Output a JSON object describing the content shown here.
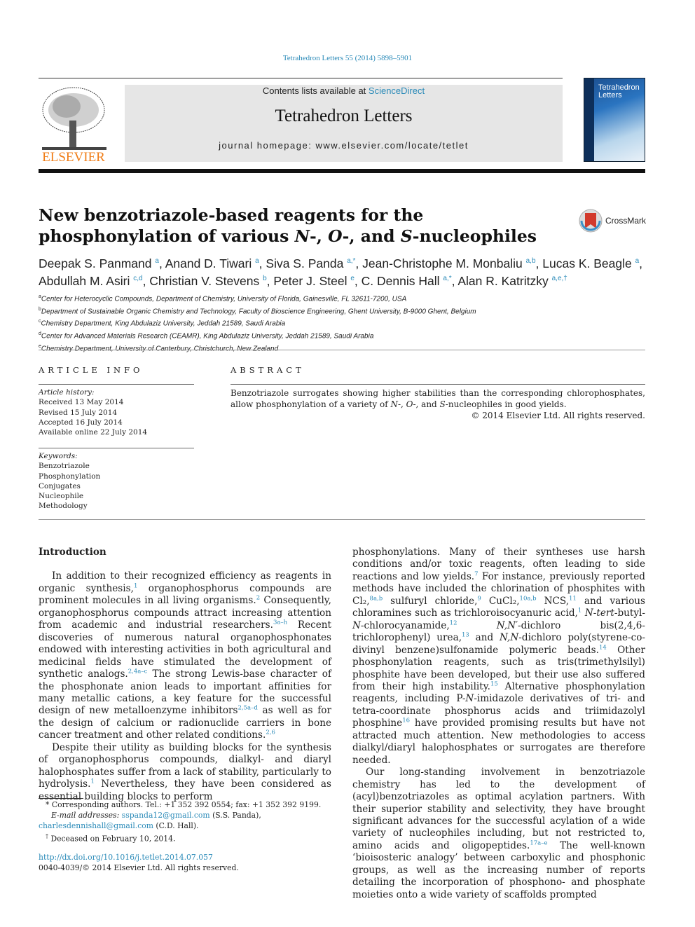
{
  "header": {
    "journal_ref": "Tetrahedron Letters 55 (2014) 5898–5901",
    "contents_prefix": "Contents lists available at ",
    "sciencedirect": "ScienceDirect",
    "journal_title": "Tetrahedron Letters",
    "homepage": "journal homepage: www.elsevier.com/locate/tetlet",
    "publisher_logo": "ELSEVIER",
    "cover_title": "Tetrahedron Letters"
  },
  "article": {
    "title_parts": [
      {
        "t": "New benzotriazole-based reagents for the phosphonylation of various "
      },
      {
        "t": "N",
        "i": true
      },
      {
        "t": "-, "
      },
      {
        "t": "O",
        "i": true
      },
      {
        "t": "-, and "
      },
      {
        "t": "S",
        "i": true
      },
      {
        "t": "-nucleophiles"
      }
    ],
    "crossmark": "CrossMark",
    "authors": [
      {
        "name": "Deepak S. Panmand",
        "aff": "a"
      },
      {
        "name": "Anand D. Tiwari",
        "aff": "a"
      },
      {
        "name": "Siva S. Panda",
        "aff": "a,*"
      },
      {
        "name": "Jean-Christophe M. Monbaliu",
        "aff": "a,b"
      },
      {
        "name": "Lucas K. Beagle",
        "aff": "a"
      },
      {
        "name": "Abdullah M. Asiri",
        "aff": "c,d"
      },
      {
        "name": "Christian V. Stevens",
        "aff": "b"
      },
      {
        "name": "Peter J. Steel",
        "aff": "e"
      },
      {
        "name": "C. Dennis Hall",
        "aff": "a,*"
      },
      {
        "name": "Alan R. Katritzky",
        "aff": "a,e,†"
      }
    ],
    "affiliations": [
      {
        "key": "a",
        "text": "Center for Heterocyclic Compounds, Department of Chemistry, University of Florida, Gainesville, FL 32611-7200, USA"
      },
      {
        "key": "b",
        "text": "Department of Sustainable Organic Chemistry and Technology, Faculty of Bioscience Engineering, Ghent University, B-9000 Ghent, Belgium"
      },
      {
        "key": "c",
        "text": "Chemistry Department, King Abdulaziz University, Jeddah 21589, Saudi Arabia"
      },
      {
        "key": "d",
        "text": "Center for Advanced Materials Research (CEAMR), King Abdulaziz University, Jeddah 21589, Saudi Arabia"
      },
      {
        "key": "e",
        "text": "Chemistry Department, University of Canterbury, Christchurch, New Zealand"
      }
    ]
  },
  "article_info": {
    "heading": "ARTICLE INFO",
    "history_label": "Article history:",
    "history": [
      "Received 13 May 2014",
      "Revised 15 July 2014",
      "Accepted 16 July 2014",
      "Available online 22 July 2014"
    ],
    "keywords_label": "Keywords:",
    "keywords": [
      "Benzotriazole",
      "Phosphonylation",
      "Conjugates",
      "Nucleophile",
      "Methodology"
    ]
  },
  "abstract": {
    "heading": "ABSTRACT",
    "parts": [
      {
        "t": "Benzotriazole surrogates showing higher stabilities than the corresponding chlorophosphates, allow phosphonylation of a variety of "
      },
      {
        "t": "N",
        "i": true
      },
      {
        "t": "-, "
      },
      {
        "t": "O",
        "i": true
      },
      {
        "t": "-, and "
      },
      {
        "t": "S",
        "i": true
      },
      {
        "t": "-nucleophiles in good yields."
      }
    ],
    "copyright": "© 2014 Elsevier Ltd. All rights reserved."
  },
  "body": {
    "section_title": "Introduction",
    "left_paragraphs": [
      [
        {
          "t": "In addition to their recognized efficiency as reagents in organic synthesis,"
        },
        {
          "c": "1"
        },
        {
          "t": " organophosphorus compounds are prominent molecules in all living organisms."
        },
        {
          "c": "2"
        },
        {
          "t": " Consequently, organophosphorus compounds attract increasing attention from academic and industrial researchers."
        },
        {
          "c": "3a–h"
        },
        {
          "t": " Recent discoveries of numerous natural organophosphonates endowed with interesting activities in both agricultural and medicinal fields have stimulated the development of synthetic analogs."
        },
        {
          "c": "2,4a–c"
        },
        {
          "t": " The strong Lewis-base character of the phosphonate anion leads to important affinities for many metallic cations, a key feature for the successful design of new metalloenzyme inhibitors"
        },
        {
          "c": "2,5a–d"
        },
        {
          "t": " as well as for the design of calcium or radionuclide carriers in bone cancer treatment and other related conditions."
        },
        {
          "c": "2,6"
        }
      ],
      [
        {
          "t": "Despite their utility as building blocks for the synthesis of organophosphorus compounds, dialkyl- and diaryl halophosphates suffer from a lack of stability, particularly to hydrolysis."
        },
        {
          "c": "1"
        },
        {
          "t": " Nevertheless, they have been considered as essential building blocks to perform"
        }
      ]
    ],
    "right_paragraphs": [
      [
        {
          "t": "phosphonylations. Many of their syntheses use harsh conditions and/or toxic reagents, often leading to side reactions and low yields."
        },
        {
          "c": "7"
        },
        {
          "t": " For instance, previously reported methods have included the chlorination of phosphites with Cl₂,"
        },
        {
          "c": "8a,b"
        },
        {
          "t": " sulfuryl chloride,"
        },
        {
          "c": "9"
        },
        {
          "t": " CuCl₂,"
        },
        {
          "c": "10a,b"
        },
        {
          "t": " NCS,"
        },
        {
          "c": "11"
        },
        {
          "t": " and various chloramines such as trichloroisocyanuric acid,"
        },
        {
          "c": "1"
        },
        {
          "t": " "
        },
        {
          "t": "N",
          "i": true
        },
        {
          "t": "-"
        },
        {
          "t": "tert",
          "i": true
        },
        {
          "t": "-butyl-"
        },
        {
          "t": "N",
          "i": true
        },
        {
          "t": "-chlorocyanamide,"
        },
        {
          "c": "12"
        },
        {
          "t": " "
        },
        {
          "t": "N,N′",
          "i": true
        },
        {
          "t": "-dichloro bis(2,4,6-trichlorophenyl) urea,"
        },
        {
          "c": "13"
        },
        {
          "t": " and "
        },
        {
          "t": "N,N",
          "i": true
        },
        {
          "t": "-dichloro poly(styrene-co-divinyl benzene)sulfonamide polymeric beads."
        },
        {
          "c": "14"
        },
        {
          "t": " Other phosphonylation reagents, such as tris(trimethylsilyl) phosphite have been developed, but their use also suffered from their high instability."
        },
        {
          "c": "15"
        },
        {
          "t": " Alternative phosphonylation reagents, including P-"
        },
        {
          "t": "N",
          "i": true
        },
        {
          "t": "-imidazole derivatives of tri- and tetra-coordinate phosphorus acids and triimidazolyl phosphine"
        },
        {
          "c": "16"
        },
        {
          "t": " have provided promising results but have not attracted much attention. New methodologies to access dialkyl/diaryl halophosphates or surrogates are therefore needed."
        }
      ],
      [
        {
          "t": "Our long-standing involvement in benzotriazole chemistry has led to the development of (acyl)benzotriazoles as optimal acylation partners. With their superior stability and selectivity, they have brought significant advances for the successful acylation of a wide variety of nucleophiles including, but not restricted to, amino acids and oligopeptides."
        },
        {
          "c": "17a–e"
        },
        {
          "t": " The well-known ‘bioisosteric analogy’ between carboxylic and phosphonic groups, as well as the increasing number of reports detailing the incorporation of phosphono- and phosphate moieties onto a wide variety of scaffolds prompted"
        }
      ]
    ]
  },
  "footnotes": {
    "corresponding": "Corresponding authors. Tel.: +1 352 392 0554; fax: +1 352 392 9199.",
    "email_label": "E-mail addresses:",
    "email1": "sspanda12@gmail.com",
    "email1_who": " (S.S. Panda), ",
    "email2": "charlesdennishall@gmail.com",
    "email2_who": " (C.D. Hall).",
    "deceased": "Deceased on February 10, 2014.",
    "star": "*",
    "dagger": "†"
  },
  "doi": {
    "link": "http://dx.doi.org/10.1016/j.tetlet.2014.07.057",
    "issn": "0040-4039/© 2014 Elsevier Ltd. All rights reserved."
  },
  "colors": {
    "link": "#2a8ab8",
    "elsevier_orange": "#f07d17",
    "banner_gray": "#e6e6e6"
  }
}
